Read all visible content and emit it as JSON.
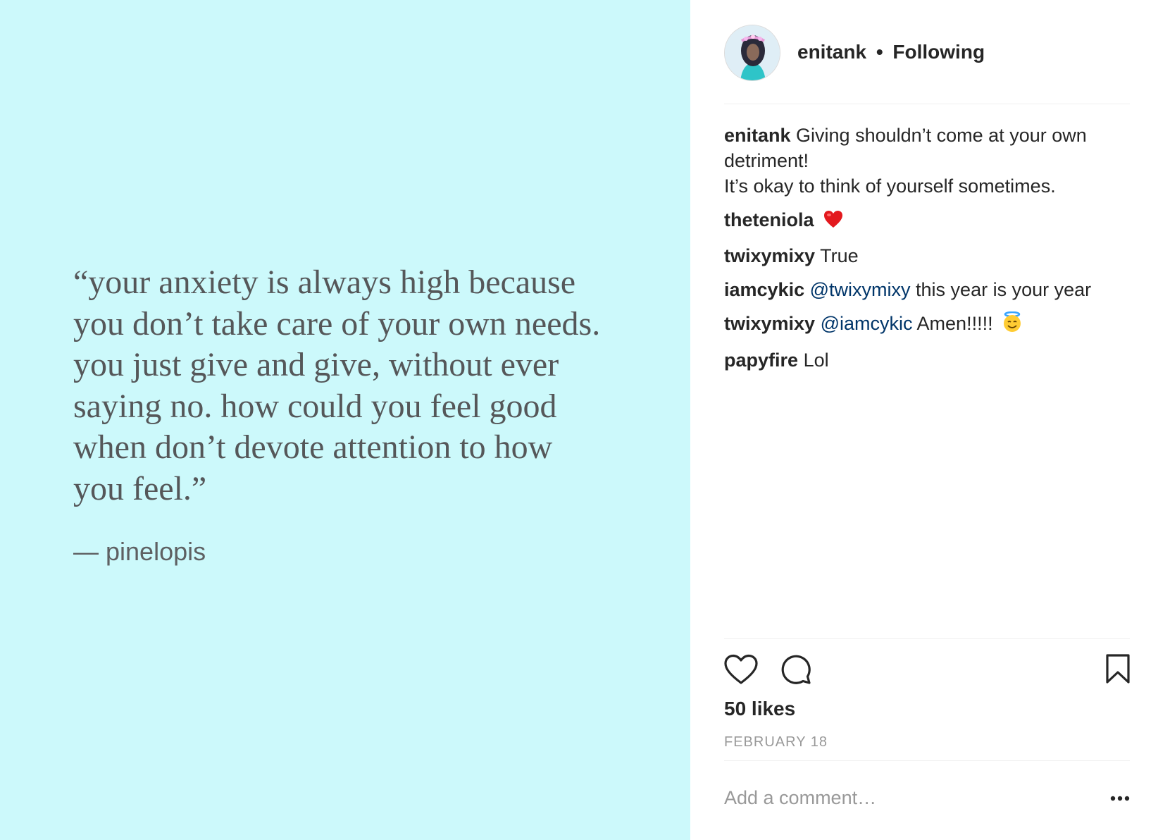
{
  "media": {
    "quote": "“your anxiety is always high because\nyou don’t take care of your own needs.\nyou just give and give, without ever\nsaying no. how could you feel good\nwhen don’t devote attention to how\nyou feel.”",
    "author": "— pinelopis",
    "background": "#ccf9fb"
  },
  "header": {
    "username": "enitank",
    "separator": "•",
    "follow_status": "Following",
    "avatar_icon": "profile-avatar"
  },
  "caption": {
    "user": "enitank",
    "text": "Giving shouldn’t come at your own detriment!\nIt’s okay to think of yourself sometimes."
  },
  "comments": [
    {
      "user": "theteniola",
      "mention": "",
      "text": "",
      "emoji": "red-heart"
    },
    {
      "user": "twixymixy",
      "mention": "",
      "text": "True",
      "emoji": ""
    },
    {
      "user": "iamcykic",
      "mention": "@twixymixy",
      "text": "this year is your year",
      "emoji": ""
    },
    {
      "user": "twixymixy",
      "mention": "@iamcykic",
      "text": "Amen!!!!!",
      "emoji": "smiling-face-with-halo"
    },
    {
      "user": "papyfire",
      "mention": "",
      "text": "Lol",
      "emoji": ""
    }
  ],
  "actions": {
    "like_icon": "heart-outline-icon",
    "comment_icon": "speech-bubble-icon",
    "save_icon": "bookmark-icon"
  },
  "likes": "50 likes",
  "date": "FEBRUARY 18",
  "add_comment": {
    "placeholder": "Add a comment…",
    "more_icon": "more-options-icon"
  },
  "colors": {
    "mention": "#003569",
    "muted": "#999999",
    "text": "#262626"
  }
}
